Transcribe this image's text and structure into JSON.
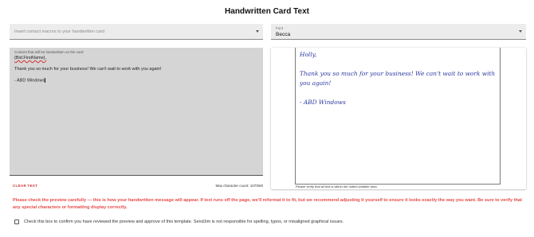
{
  "page": {
    "title": "Handwritten Card Text"
  },
  "macro_select": {
    "placeholder": "Insert contact macros to your handwritten card",
    "caret_icon": "chevron-down-icon"
  },
  "font_select": {
    "label": "Font",
    "value": "Becca",
    "caret_icon": "chevron-down-icon"
  },
  "editor": {
    "label": "Content that will be handwritten on the card",
    "lines": [
      "{Bid.FirstName},",
      "",
      "Thank you so much for your business! We can't wait to work with you again!",
      "",
      "- ABD Windows"
    ]
  },
  "actions": {
    "clear_label": "CLEAR TEXT",
    "max_count": "Max character count: 107/500"
  },
  "preview": {
    "lines": [
      "Holly,",
      "",
      "Thank you so much for your business! We can't wait to work with",
      "you again!",
      "",
      "- ABD Windows"
    ],
    "note": "Please verify that all text is within the dotted writable area."
  },
  "warning": "Please check the preview carefully — this is how your handwritten message will appear. If text runs off the page, we'll reformat it to fit, but we recommend adjusting it yourself to ensure it looks exactly the way you want. Be sure to verify that any special characters or formatting display correctly.",
  "confirm": {
    "label": "Check this box to confirm you have reviewed the preview and approve of this template. SendJim is not responsible for spelling, typos, or misaligned graphical issues.",
    "checked": false
  },
  "colors": {
    "accent": "#d32f2f",
    "warning": "#e84a4a",
    "handwriting": "#2d3aa0"
  }
}
